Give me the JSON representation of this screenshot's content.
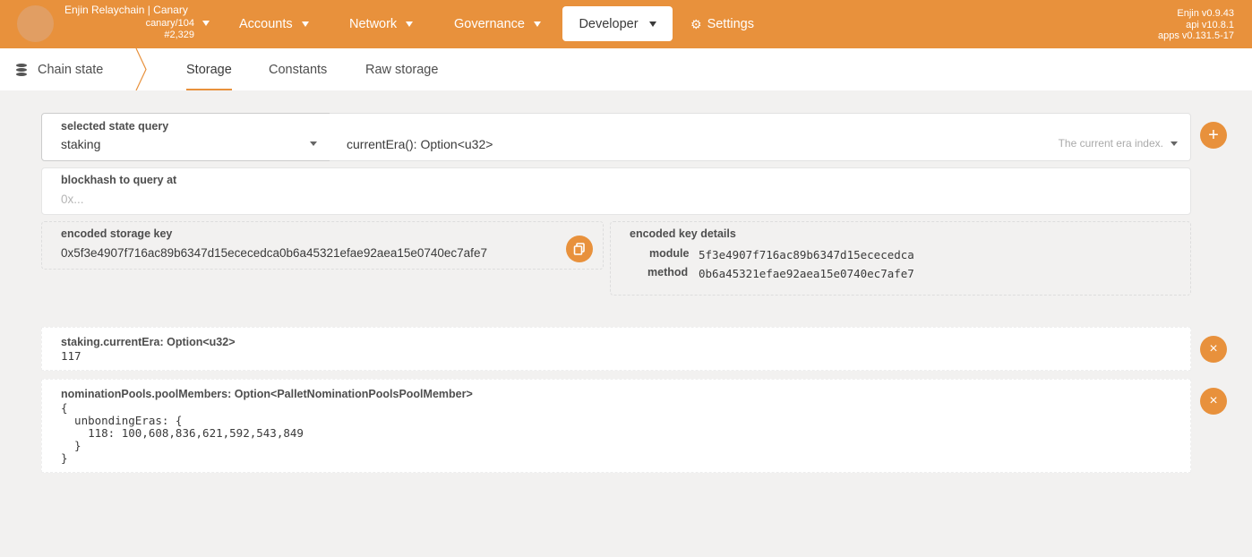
{
  "chain": {
    "name": "Enjin Relaychain | Canary",
    "spec": "canary/104",
    "block": "#2,329"
  },
  "nav": {
    "accounts": "Accounts",
    "network": "Network",
    "governance": "Governance",
    "developer": "Developer",
    "settings": "Settings"
  },
  "versions": {
    "node": "Enjin v0.9.43",
    "api": "api v10.8.1",
    "apps": "apps v0.131.5-17"
  },
  "subnav": {
    "section": "Chain state",
    "tabs": [
      "Storage",
      "Constants",
      "Raw storage"
    ]
  },
  "query": {
    "section_label": "selected state query",
    "section_value": "staking",
    "method_value": "currentEra(): Option<u32>",
    "method_hint": "The current era index.",
    "blockhash_label": "blockhash to query at",
    "blockhash_placeholder": "0x...",
    "encoded_label": "encoded storage key",
    "encoded_value": "0x5f3e4907f716ac89b6347d15ececedca0b6a45321efae92aea15e0740ec7afe7",
    "details_label": "encoded key details",
    "module_label": "module",
    "module_value": "5f3e4907f716ac89b6347d15ececedca",
    "method_label": "method",
    "method_hash": "0b6a45321efae92aea15e0740ec7afe7"
  },
  "results": [
    {
      "title": "staking.currentEra: Option<u32>",
      "value": "117"
    },
    {
      "title": "nominationPools.poolMembers: Option<PalletNominationPoolsPoolMember>",
      "value": "{\n  unbondingEras: {\n    118: 100,608,836,621,592,543,849\n  }\n}"
    }
  ],
  "icons": {
    "add": "plus-icon",
    "copy": "copy-icon",
    "remove": "close-icon",
    "settings": "gear-icon",
    "section": "database-icon"
  },
  "colors": {
    "accent": "#e8913c",
    "background": "#f2f1f0"
  }
}
